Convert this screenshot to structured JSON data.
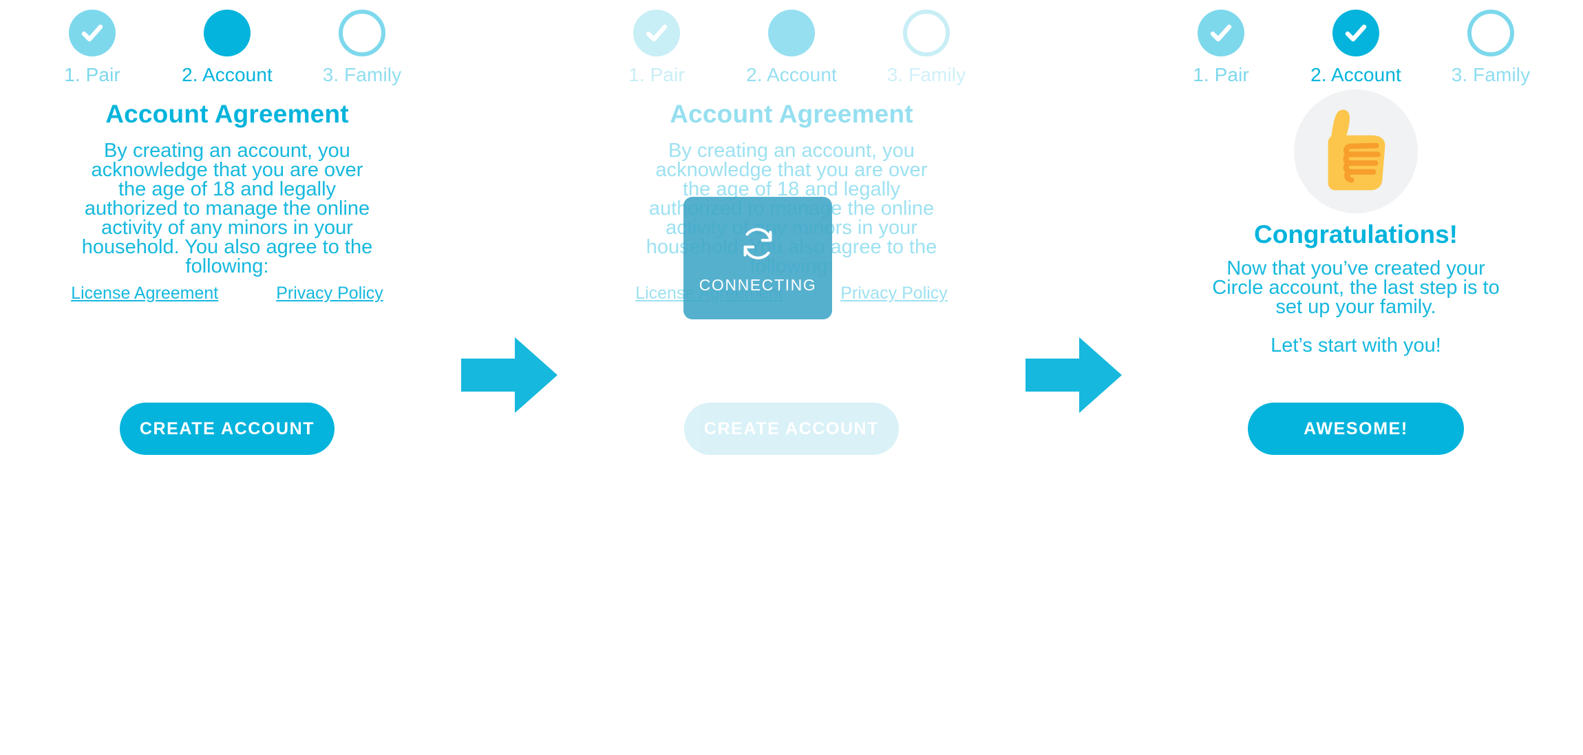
{
  "colors": {
    "accent": "#05B4DC",
    "accent_light": "#7DD8EC",
    "body_text": "#16B8DE",
    "disabled_button": "#A7DFEE",
    "overlay": "#3DA5C6",
    "thumb_disc": "#F0F2F4",
    "thumb_yellow": "#FCC64C",
    "thumb_outline": "#F79E2D",
    "arrow": "#16B8DE"
  },
  "stepper": {
    "steps": [
      {
        "label": "1. Pair",
        "state": "done",
        "icon": "check-icon"
      },
      {
        "label": "2. Account",
        "state": "active",
        "icon": "none"
      },
      {
        "label": "3. Family",
        "state": "empty",
        "icon": "none"
      }
    ],
    "steps_final": [
      {
        "label": "1. Pair",
        "state": "done",
        "icon": "check-icon"
      },
      {
        "label": "2. Account",
        "state": "active-done",
        "icon": "check-icon"
      },
      {
        "label": "3. Family",
        "state": "empty",
        "icon": "none"
      }
    ]
  },
  "panel1": {
    "title": "Account Agreement",
    "body_lines": [
      "By creating an account, you",
      "acknowledge that you are over",
      "the age of 18 and legally",
      "authorized to manage the online",
      "activity of any minors in your",
      "household. You also agree to the",
      "following:"
    ],
    "link_license": "License Agreement",
    "link_privacy": "Privacy Policy",
    "button_label": "CREATE ACCOUNT"
  },
  "panel2": {
    "title": "Account Agreement",
    "body_lines": [
      "By creating an account, you",
      "acknowledge that you are over",
      "the age of 18 and legally",
      "authorized to manage the online",
      "activity of any minors in your",
      "household. You also agree to the",
      "following:"
    ],
    "link_license": "License Agreement",
    "link_privacy": "Privacy Policy",
    "button_label": "CREATE ACCOUNT",
    "overlay_label": "CONNECTING",
    "overlay_icon": "sync-icon"
  },
  "panel3": {
    "hero_icon": "thumbs-up-icon",
    "title": "Congratulations!",
    "body_lines": [
      "Now that you’ve created your",
      "Circle account, the last step is to",
      "set up your family.",
      "",
      "Let’s start with you!"
    ],
    "button_label": "AWESOME!"
  },
  "arrows": {
    "icon": "right-arrow-icon",
    "count": 2
  }
}
